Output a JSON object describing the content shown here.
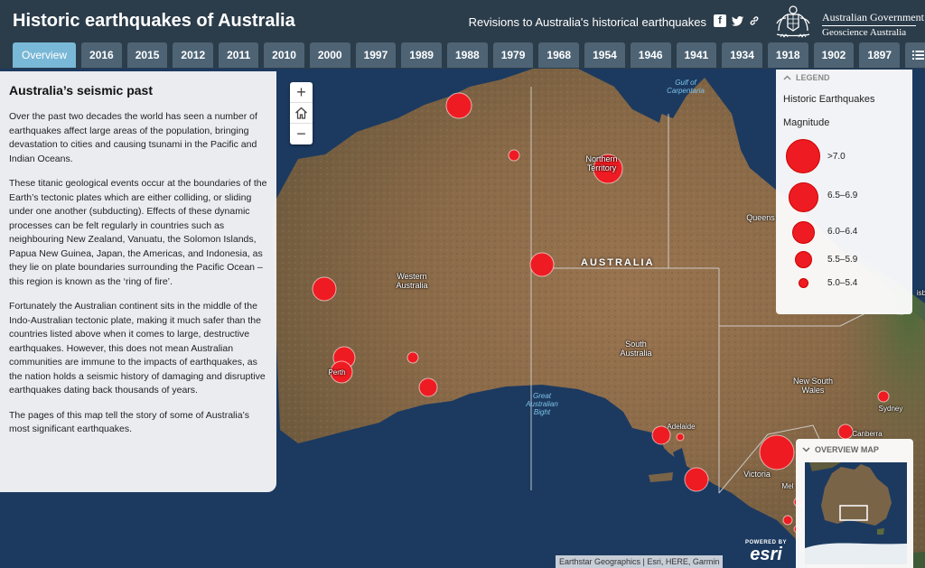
{
  "header": {
    "title": "Historic earthquakes of Australia",
    "subtitle_link": "Revisions to Australia's historical earthquakes",
    "logo_line1": "Australian Government",
    "logo_line2": "Geoscience Australia",
    "share_icons": [
      "facebook-icon",
      "twitter-icon",
      "link-icon"
    ]
  },
  "tabs": [
    "Overview",
    "2016",
    "2015",
    "2012",
    "2011",
    "2010",
    "2000",
    "1997",
    "1989",
    "1988",
    "1979",
    "1968",
    "1954",
    "1946",
    "1941",
    "1934",
    "1918",
    "1902",
    "1897"
  ],
  "active_tab": "Overview",
  "story": {
    "title": "Australia’s seismic past",
    "paragraphs": [
      "Over the past two decades the world has seen a number of earthquakes affect large areas of the population, bringing devastation to cities and causing tsunami in the Pacific and Indian Oceans.",
      "These titanic geological events occur at the boundaries of the Earth’s tectonic plates which are either colliding, or sliding under one another (subducting). Effects of these dynamic processes can be felt regularly in countries such as neighbouring New Zealand, Vanuatu, the Solomon Islands, Papua New Guinea, Japan, the Americas, and Indonesia, as they lie on plate boundaries surrounding the Pacific Ocean – this region is known as the ‘ring of fire’.",
      "Fortunately the Australian continent sits in the middle of the Indo-Australian tectonic plate, making it much safer than the countries listed above when it comes to large, destructive earthquakes. However, this does not mean Australian communities are immune to the impacts of earthquakes, as the nation holds a seismic history of damaging and disruptive earthquakes dating back thousands of years.",
      "The pages of this map tell the story of some of Australia’s most significant earthquakes."
    ]
  },
  "map": {
    "zoom_in": "+",
    "zoom_out": "−",
    "labels": {
      "australia": "AUSTRALIA",
      "northern_territory": "Northern\nTerritory",
      "western_australia": "Western\nAustralia",
      "south_australia": "South\nAustralia",
      "new_south_wales": "New South\nWales",
      "queensland": "Queens",
      "victoria": "Victoria",
      "perth": "Perth",
      "adelaide": "Adelaide",
      "sydney": "Sydney",
      "canberra": "Canberra",
      "melbourne": "Mel",
      "brisbane": "isb",
      "gulf": "Gulf of\nCarpentaria",
      "bight": "Great\nAustralian\nBight"
    },
    "attribution": "Earthstar Geographics | Esri, HERE, Garmin",
    "esri_powered": "POWERED BY",
    "esri_name": "esri",
    "colors": {
      "quake": "#ee1c22",
      "ocean": "#1d3b62",
      "land": "#8a6b48"
    }
  },
  "legend": {
    "heading": "LEGEND",
    "layer": "Historic Earthquakes",
    "field": "Magnitude",
    "classes": [
      "&gt;7.0",
      "6.5–6.9",
      "6.0–6.4",
      "5.5–5.9",
      "5.0–5.4"
    ]
  },
  "overview": {
    "heading": "OVERVIEW MAP"
  }
}
